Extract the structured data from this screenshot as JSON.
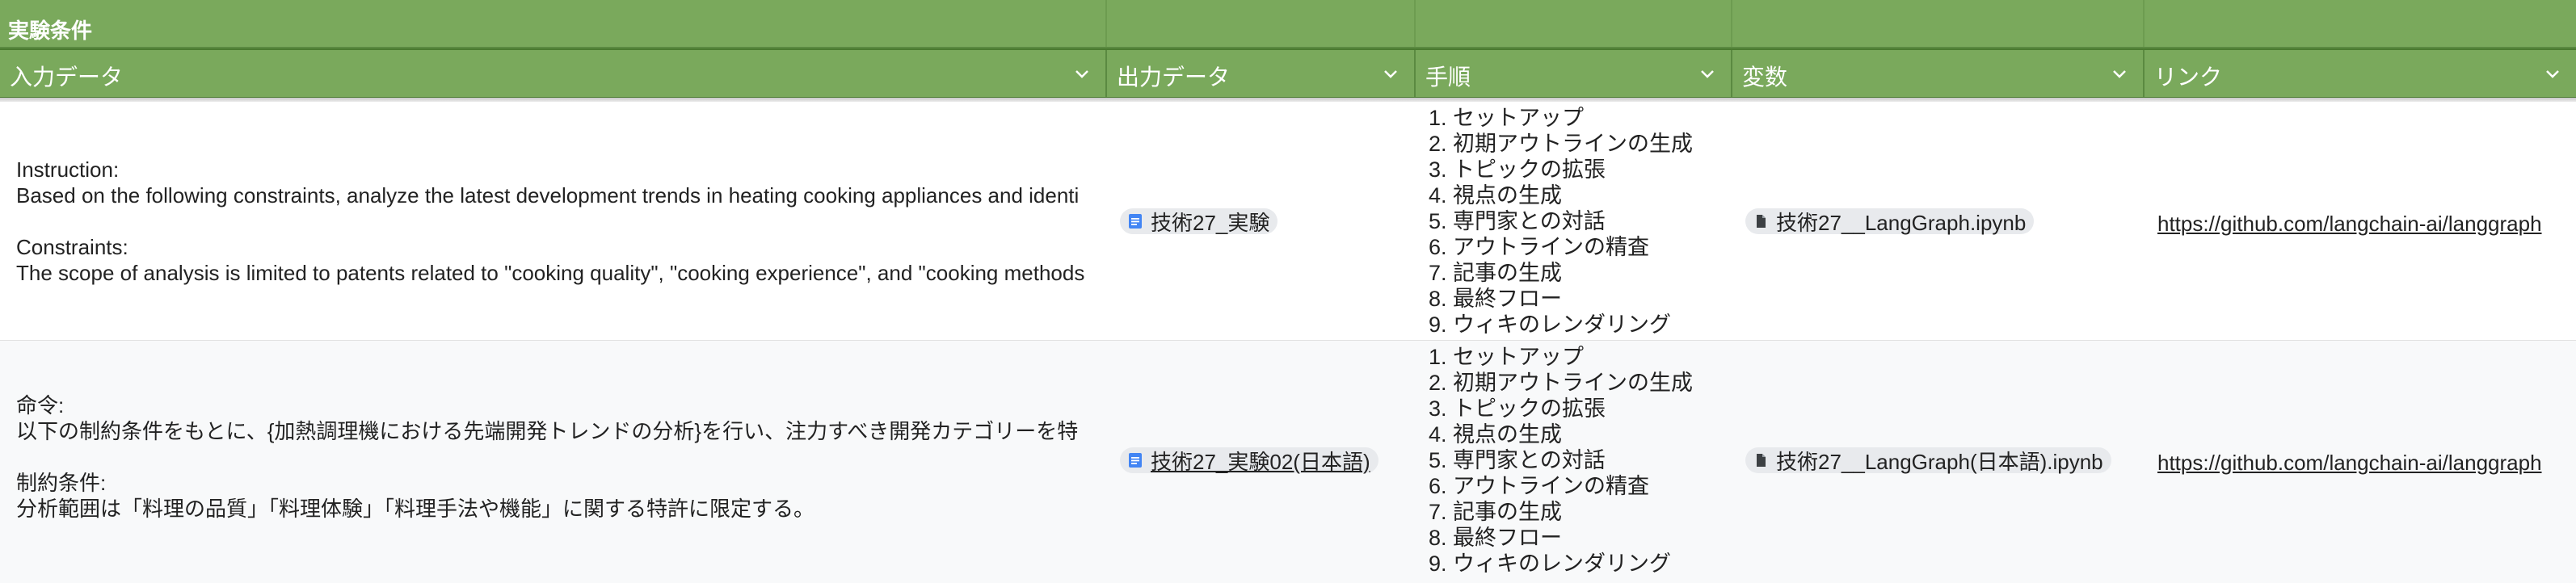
{
  "title": "実験条件",
  "headers": {
    "input": "入力データ",
    "output": "出力データ",
    "steps": "手順",
    "vars": "変数",
    "link": "リンク"
  },
  "rows": [
    {
      "input": "Instruction:\nBased on the following constraints, analyze the latest development trends in heating cooking appliances and identi\n\nConstraints:\nThe scope of analysis is limited to patents related to \"cooking quality\", \"cooking experience\", and \"cooking methods",
      "output": "技術27_実験",
      "steps": [
        "1. セットアップ",
        "2. 初期アウトラインの生成",
        "3. トピックの拡張",
        "4. 視点の生成",
        "5. 専門家との対話",
        "6. アウトラインの精査",
        "7. 記事の生成",
        "8. 最終フロー",
        "9. ウィキのレンダリング"
      ],
      "vars": "技術27__LangGraph.ipynb",
      "link": "https://github.com/langchain-ai/langgraph"
    },
    {
      "input": "命令:\n以下の制約条件をもとに、{加熱調理機における先端開発トレンドの分析}を行い、注力すべき開発カテゴリーを特\n\n制約条件:\n分析範囲は「料理の品質」「料理体験」「料理手法や機能」に関する特許に限定する。",
      "output": "技術27_実験02(日本語)",
      "steps": [
        "1. セットアップ",
        "2. 初期アウトラインの生成",
        "3. トピックの拡張",
        "4. 視点の生成",
        "5. 専門家との対話",
        "6. アウトラインの精査",
        "7. 記事の生成",
        "8. 最終フロー",
        "9. ウィキのレンダリング"
      ],
      "vars": "技術27__LangGraph(日本語).ipynb",
      "link": "https://github.com/langchain-ai/langgraph"
    }
  ],
  "icons": {
    "header_dropdown": "chevron-down-icon",
    "output_chip": "google-docs-icon",
    "vars_chip": "file-icon"
  },
  "colors": {
    "header_green": "#7aa95c",
    "doc_blue": "#4285f4",
    "row_alt": "#f8f9fa"
  }
}
